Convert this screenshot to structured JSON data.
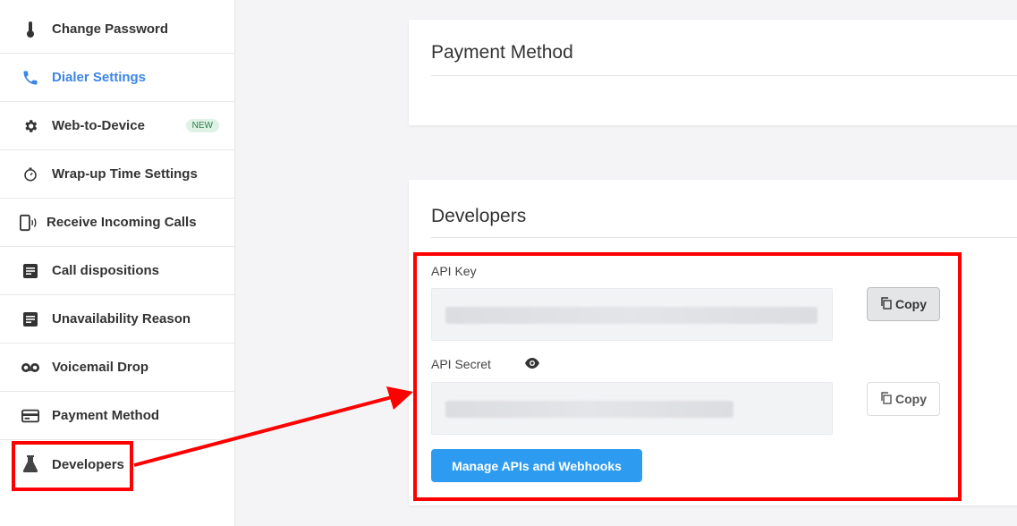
{
  "sidebar": {
    "items": [
      {
        "label": "Change Password",
        "icon": "thermometer-icon"
      },
      {
        "label": "Dialer Settings",
        "icon": "phone-icon"
      },
      {
        "label": "Web-to-Device",
        "icon": "gear-icon",
        "badge": "NEW"
      },
      {
        "label": "Wrap-up Time Settings",
        "icon": "timer-icon"
      },
      {
        "label": "Receive Incoming Calls",
        "icon": "device-ring-icon"
      },
      {
        "label": "Call dispositions",
        "icon": "document-icon"
      },
      {
        "label": "Unavailability Reason",
        "icon": "document-icon"
      },
      {
        "label": "Voicemail Drop",
        "icon": "voicemail-icon"
      },
      {
        "label": "Payment Method",
        "icon": "credit-card-icon"
      },
      {
        "label": "Developers",
        "icon": "flask-icon"
      }
    ],
    "active_color": "#3b86e6"
  },
  "payment_card": {
    "title": "Payment Method"
  },
  "developers_card": {
    "title": "Developers",
    "api_key_label": "API Key",
    "api_secret_label": "API Secret",
    "copy_label": "Copy",
    "manage_button": "Manage APIs and Webhooks"
  },
  "colors": {
    "primary": "#2d9cf0",
    "highlight": "#ff0000",
    "new_badge_bg": "#dff2e6"
  }
}
